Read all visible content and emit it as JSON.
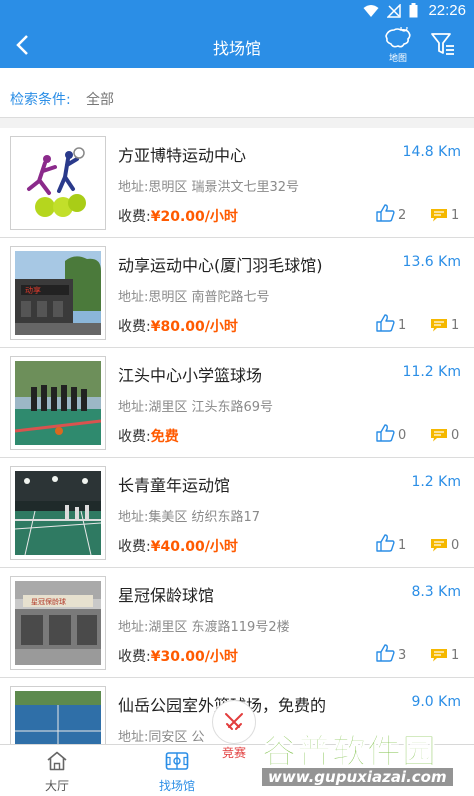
{
  "status": {
    "time": "22:26"
  },
  "header": {
    "title": "找场馆",
    "map_label": "地图"
  },
  "condition": {
    "label": "检索条件:",
    "value": "全部"
  },
  "venues": [
    {
      "name": "方亚博特运动中心",
      "distance": "14.8 Km",
      "address": "地址:思明区 瑞景洪文七里32号",
      "fee_label": "收费:",
      "fee": "¥20.00/小时",
      "likes": "2",
      "comments": "1"
    },
    {
      "name": "动享运动中心(厦门羽毛球馆)",
      "distance": "13.6 Km",
      "address": "地址:思明区 南普陀路七号",
      "fee_label": "收费:",
      "fee": "¥80.00/小时",
      "likes": "1",
      "comments": "1"
    },
    {
      "name": "江头中心小学篮球场",
      "distance": "11.2 Km",
      "address": "地址:湖里区 江头东路69号",
      "fee_label": "收费:",
      "fee": "免费",
      "likes": "0",
      "comments": "0"
    },
    {
      "name": "长青童年运动馆",
      "distance": "1.2 Km",
      "address": "地址:集美区 纺织东路17",
      "fee_label": "收费:",
      "fee": "¥40.00/小时",
      "likes": "1",
      "comments": "0"
    },
    {
      "name": "星冠保龄球馆",
      "distance": "8.3 Km",
      "address": "地址:湖里区 东渡路119号2楼",
      "fee_label": "收费:",
      "fee": "¥30.00/小时",
      "likes": "3",
      "comments": "1"
    },
    {
      "name": "仙岳公园室外篮球场，免费的",
      "distance": "9.0 Km",
      "address": "地址:同安区 公",
      "fee_label": "",
      "fee": "",
      "likes": "",
      "comments": ""
    }
  ],
  "nav": {
    "hall": "大厅",
    "venues": "找场馆",
    "contest": "竞赛"
  },
  "watermark": {
    "big": "谷普软件园",
    "small": "www.gupuxiazai.com"
  },
  "colors": {
    "accent": "#2b8ee6",
    "price": "#ff5a00",
    "comment_icon": "#f5b800"
  }
}
